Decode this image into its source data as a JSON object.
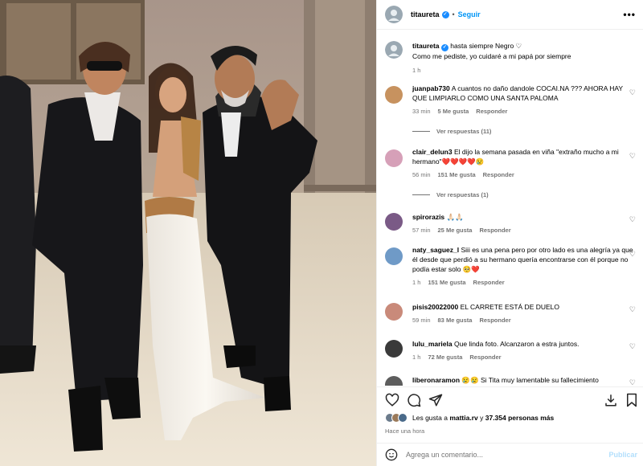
{
  "post": {
    "username": "titaureta",
    "follow_label": "Seguir",
    "more_label": "•••",
    "caption_line1": "hasta siempre Negro ♡",
    "caption_line2": "Como me pediste, yo cuidaré a mi papá por siempre",
    "caption_time": "1 h"
  },
  "comments": [
    {
      "user": "juanpab730",
      "text": "A cuantos no daño dandole COCAI.NA ??? AHORA HAY QUE LIMPIARLO COMO UNA SANTA PALOMA",
      "time": "33 min",
      "likes": "5 Me gusta",
      "reply": "Responder",
      "view_replies": "Ver respuestas (11)",
      "avatar_color": "#c7925f"
    },
    {
      "user": "clair_delun3",
      "text": "El dijo la semana pasada en viña \"extraño mucho a mi hermano\"❤️❤️❤️❤️😢",
      "time": "56 min",
      "likes": "151 Me gusta",
      "reply": "Responder",
      "view_replies": "Ver respuestas (1)",
      "avatar_color": "#d6a0b8"
    },
    {
      "user": "spirorazis",
      "text": "🙏🏻🙏🏻",
      "time": "57 min",
      "likes": "25 Me gusta",
      "reply": "Responder",
      "avatar_color": "#7a5a86"
    },
    {
      "user": "naty_saguez_l",
      "text": "Siii es una pena pero por otro lado es una alegría ya que él desde que perdió a su hermano quería encontrarse con él porque no podía estar solo 🥺❤️",
      "time": "1 h",
      "likes": "151 Me gusta",
      "reply": "Responder",
      "avatar_color": "#6f9ac7"
    },
    {
      "user": "pisis20022000",
      "text": "EL CARRETE ESTÁ DE DUELO",
      "time": "59 min",
      "likes": "83 Me gusta",
      "reply": "Responder",
      "avatar_color": "#c98a7a"
    },
    {
      "user": "lulu_mariela",
      "text": "Que linda foto. Alcanzaron a estra juntos.",
      "time": "1 h",
      "likes": "72 Me gusta",
      "reply": "Responder",
      "avatar_color": "#3a3a3a"
    },
    {
      "user": "liberonaramon",
      "text": "😢😢 Si Tita muy lamentable su fallecimiento",
      "avatar_color": "#5d5d5d"
    }
  ],
  "likes": {
    "prefix": "Les gusta a ",
    "user": "mattia.rv",
    "middle": " y ",
    "count": "37.354 personas más"
  },
  "posted_ago": "Hace una hora",
  "comment_input": {
    "placeholder": "Agrega un comentario...",
    "publish_label": "Publicar"
  },
  "icons": [
    "heart-icon",
    "comment-icon",
    "share-icon",
    "download-icon",
    "bookmark-icon",
    "emoji-icon"
  ],
  "colors": {
    "accent": "#0095f6",
    "verified": "#1a8cff",
    "muted": "#737373"
  }
}
